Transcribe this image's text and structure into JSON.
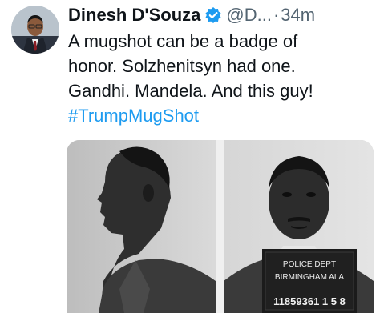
{
  "author": {
    "name": "Dinesh D'Souza",
    "handle": "@D...",
    "separator": "·",
    "time": "34m",
    "avatar_icon": "avatar-photo",
    "verified_icon": "verified-badge-icon",
    "verified_color": "#1d9bf0"
  },
  "tweet": {
    "lines": [
      "A mugshot can be a badge of",
      "honor. Solzhenitsyn had one.",
      "Gandhi. Mandela. And this guy!"
    ],
    "hashtag": "#TrumpMugShot",
    "hashtag_color": "#1d9bf0"
  },
  "media": {
    "placard_line1": "POLICE DEPT",
    "placard_line2": "BIRMINGHAM ALA",
    "placard_number": "11859361 1 5 8"
  }
}
